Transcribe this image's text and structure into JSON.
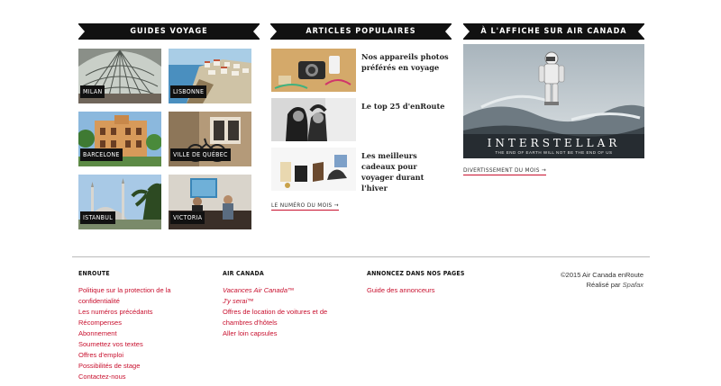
{
  "sections": {
    "guides_title": "GUIDES VOYAGE",
    "articles_title": "ARTICLES POPULAIRES",
    "affiche_title": "À L'AFFICHE SUR AIR CANADA"
  },
  "guides": [
    {
      "label": "MILAN"
    },
    {
      "label": "LISBONNE"
    },
    {
      "label": "BARCELONE"
    },
    {
      "label": "VILLE DE QUÉBEC"
    },
    {
      "label": "ISTANBUL"
    },
    {
      "label": "VICTORIA"
    }
  ],
  "articles": [
    {
      "title": "Nos appareils photos préférés en voyage"
    },
    {
      "title": "Le top 25 d'enRoute"
    },
    {
      "title": "Les meilleurs cadeaux pour voyager durant l'hiver"
    }
  ],
  "articles_link": "LE NUMÉRO DU MOIS →",
  "affiche": {
    "movie_title": "INTERSTELLAR",
    "tagline": "THE END OF EARTH WILL NOT BE THE END OF US",
    "link": "DIVERTISSEMENT DU MOIS →"
  },
  "footer": {
    "col1": {
      "heading": "ENROUTE",
      "links": [
        "Politique sur la protection de la confidentialité",
        "Les numéros précédants",
        "Récompenses",
        "Abonnement",
        "Soumettez vos textes",
        "Offres d'emploi",
        "Possibilités de stage",
        "Contactez-nous"
      ]
    },
    "col2": {
      "heading": "AIR CANADA",
      "links": [
        "Vacances Air Canada™",
        "J'y serai™",
        "Offres de location de voitures et de chambres d'hôtels",
        "Aller loin capsules"
      ]
    },
    "col3": {
      "heading": "ANNONCEZ DANS NOS PAGES",
      "links": [
        "Guide des annonceurs"
      ]
    },
    "copyright": "©2015 Air Canada enRoute",
    "realise_prefix": "Réalisé par",
    "realise_by": "Spafax"
  },
  "colors": {
    "accent": "#c8102e",
    "banner": "#111111",
    "text": "#222222"
  },
  "icons": {
    "arrow": "arrow-right-icon"
  }
}
